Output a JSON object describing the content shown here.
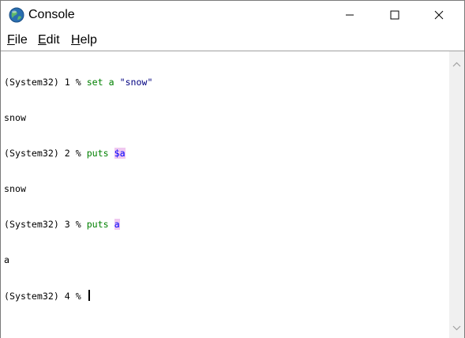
{
  "window": {
    "title": "Console",
    "app_icon": "globe-icon",
    "controls": [
      "minimize-icon",
      "maximize-icon",
      "close-icon"
    ]
  },
  "menubar": {
    "file": {
      "mnemonic": "F",
      "rest": "ile"
    },
    "edit": {
      "mnemonic": "E",
      "rest": "dit"
    },
    "help": {
      "mnemonic": "H",
      "rest": "elp"
    }
  },
  "console": {
    "line1": {
      "prompt": "(System32) 1 % ",
      "command": "set a ",
      "arg": "\"snow\""
    },
    "line2": {
      "output": "snow"
    },
    "line3": {
      "prompt": "(System32) 2 % ",
      "command": "puts ",
      "var": "$a"
    },
    "line4": {
      "output": "snow"
    },
    "line5": {
      "prompt": "(System32) 3 % ",
      "command": "puts ",
      "var": "a"
    },
    "line6": {
      "output": "a"
    },
    "line7": {
      "prompt": "(System32) 4 % "
    }
  },
  "colors": {
    "command": "#008000",
    "string": "#000080",
    "variable": "#0000ff",
    "variable_highlight": "#f0c8f0"
  }
}
